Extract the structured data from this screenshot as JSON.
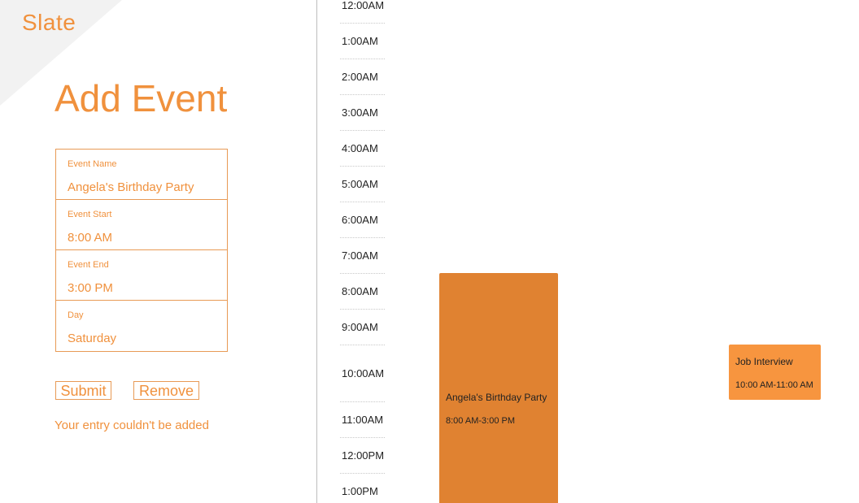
{
  "app": {
    "logo": "Slate"
  },
  "form": {
    "title": "Add Event",
    "fields": [
      {
        "label": "Event Name",
        "value": "Angela's Birthday Party"
      },
      {
        "label": "Event Start",
        "value": "8:00 AM"
      },
      {
        "label": "Event End",
        "value": "3:00 PM"
      },
      {
        "label": "Day",
        "value": "Saturday"
      }
    ],
    "submit_label": "Submit",
    "remove_label": "Remove",
    "error_message": "Your entry couldn't be added"
  },
  "timeline": {
    "hours": [
      "12:00AM",
      "1:00AM",
      "2:00AM",
      "3:00AM",
      "4:00AM",
      "5:00AM",
      "6:00AM",
      "7:00AM",
      "8:00AM",
      "9:00AM",
      "10:00AM",
      "11:00AM",
      "12:00PM",
      "1:00PM"
    ]
  },
  "events": [
    {
      "title": "Angela's Birthday Party",
      "time": "8:00 AM-3:00 PM",
      "color": "#e08231"
    },
    {
      "title": "Job Interview",
      "time": "10:00 AM-11:00 AM",
      "color": "#f7953f"
    }
  ],
  "colors": {
    "accent": "#f0913d",
    "corner": "#f2f2f2"
  }
}
